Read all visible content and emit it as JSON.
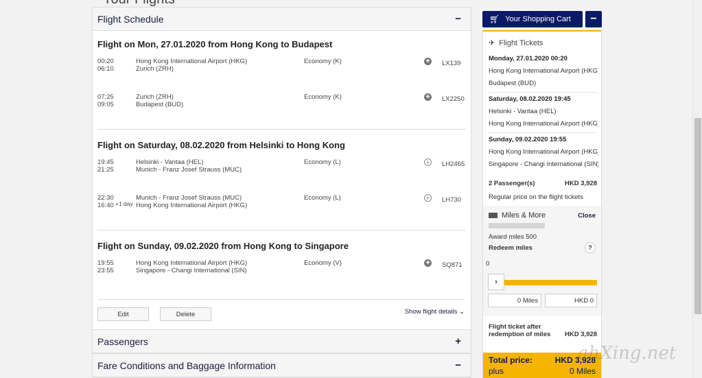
{
  "page": {
    "title": "Your Flights"
  },
  "schedule": {
    "header": "Flight Schedule",
    "toggle": "−",
    "flights": [
      {
        "title": "Flight on Mon, 27.01.2020 from Hong Kong to Budapest",
        "legs": [
          {
            "dep_time": "00:20",
            "arr_time": "06:10",
            "plus_day": "",
            "from": "Hong Kong International Airport (HKG)",
            "to": "Zurich (ZRH)",
            "cabin": "Economy (K)",
            "icon": "swiss-airline-icon",
            "flight_no": "LX139"
          },
          {
            "dep_time": "07:25",
            "arr_time": "09:05",
            "plus_day": "",
            "from": "Zurich (ZRH)",
            "to": "Budapest (BUD)",
            "cabin": "Economy (K)",
            "icon": "swiss-airline-icon",
            "flight_no": "LX2250"
          }
        ]
      },
      {
        "title": "Flight on Saturday, 08.02.2020 from Helsinki to Hong Kong",
        "legs": [
          {
            "dep_time": "19:45",
            "arr_time": "21:25",
            "plus_day": "",
            "from": "Helsinki - Vantaa (HEL)",
            "to": "Munich - Franz Josef Strauss (MUC)",
            "cabin": "Economy (L)",
            "icon": "lufthansa-airline-icon",
            "flight_no": "LH2465"
          },
          {
            "dep_time": "22:30",
            "arr_time": "16:40",
            "plus_day": "+1 day",
            "from": "Munich - Franz Josef Strauss (MUC)",
            "to": "Hong Kong International Airport (HKG)",
            "cabin": "Economy (L)",
            "icon": "lufthansa-airline-icon",
            "flight_no": "LH730"
          }
        ]
      },
      {
        "title": "Flight on Sunday, 09.02.2020 from Hong Kong to Singapore",
        "legs": [
          {
            "dep_time": "19:55",
            "arr_time": "23:55",
            "plus_day": "",
            "from": "Hong Kong International Airport (HKG)",
            "to": "Singapore - Changi International (SIN)",
            "cabin": "Economy (V)",
            "icon": "singapore-airline-icon",
            "flight_no": "SQ871"
          }
        ]
      }
    ],
    "edit_label": "Edit",
    "delete_label": "Delete",
    "show_details": "Show flight details ⌄"
  },
  "passengers": {
    "header": "Passengers",
    "toggle": "+"
  },
  "fare": {
    "header": "Fare Conditions and Baggage Information",
    "toggle": "−"
  },
  "cart": {
    "button_label": "Your Shopping Cart",
    "collapse": "−",
    "tickets_header": "Flight Tickets",
    "items": [
      {
        "date": "Monday, 27.01.2020 00:20",
        "from": "Hong Kong International Airport (HKG)",
        "to": "Budapest (BUD)"
      },
      {
        "date": "Saturday, 08.02.2020 19:45",
        "from": "Helsinki - Vantaa (HEL)",
        "to": "Hong Kong International Airport (HKG)"
      },
      {
        "date": "Sunday, 09.02.2020 19:55",
        "from": "Hong Kong International Airport (HKG)",
        "to": "Singapore - Changi International (SIN)"
      }
    ],
    "passengers_label": "2 Passenger(s)",
    "passengers_price": "HKD 3,928",
    "regular_note": "Regular price on the flight tickets",
    "miles": {
      "header": "Miles & More",
      "close": "Close",
      "award": "Award miles 500",
      "redeem": "Redeem miles",
      "help": "?",
      "min": "0",
      "knob": "›",
      "slider_fraction": 0,
      "miles_value": "0 Miles",
      "hkd_value": "HKD 0"
    },
    "after_label": "Flight ticket after redemption of miles",
    "after_value": "HKD 3,928",
    "total_label": "Total price:",
    "total_value": "HKD 3,928",
    "plus_label": "plus",
    "plus_value": "0 Miles"
  },
  "watermark": "ahXing.net"
}
